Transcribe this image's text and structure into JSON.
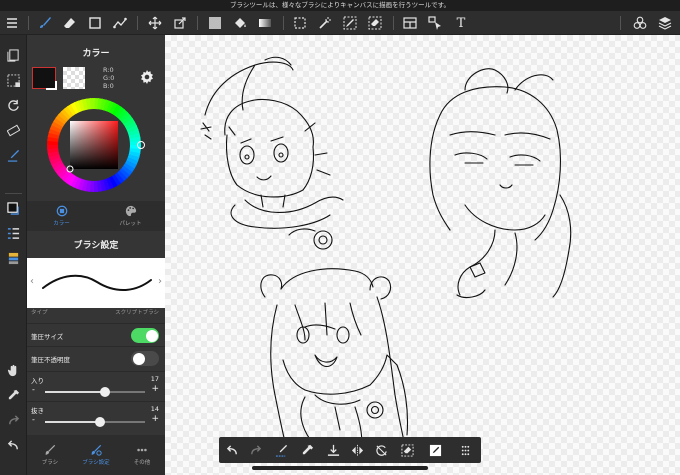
{
  "tooltip": "ブラシツールは、様々なブラシによりキャンバスに描画を行うツールです。",
  "color_panel": {
    "title": "カラー",
    "r": "R:0",
    "g": "G:0",
    "b": "B:0",
    "tabs": [
      {
        "label": "カラー",
        "icon": "color-circle-icon",
        "active": true
      },
      {
        "label": "パレット",
        "icon": "palette-icon",
        "active": false
      }
    ]
  },
  "brush_settings": {
    "title": "ブラシ設定",
    "type_label": "タイプ",
    "brush_name": "スクリプトブラシ",
    "pressure_size_label": "筆圧サイズ",
    "pressure_size_on": true,
    "pressure_opacity_label": "筆圧不透明度",
    "pressure_opacity_on": false,
    "entry_label": "入り",
    "entry_value": "17",
    "entry_fraction": 0.6,
    "exit_label": "抜き",
    "exit_value": "14",
    "exit_fraction": 0.55
  },
  "bottom_tabs": [
    {
      "label": "ブラシ",
      "icon": "brush-icon",
      "active": false
    },
    {
      "label": "ブラシ設定",
      "icon": "brush-settings-icon",
      "active": true
    },
    {
      "label": "その他",
      "icon": "more-icon",
      "active": false
    }
  ],
  "toolbar_text_tool": "T",
  "colors": {
    "accent": "#4a90e2",
    "toggle_on": "#4cd964",
    "panel_bg": "#353535",
    "toolbar_bg": "#2e2e2e"
  }
}
